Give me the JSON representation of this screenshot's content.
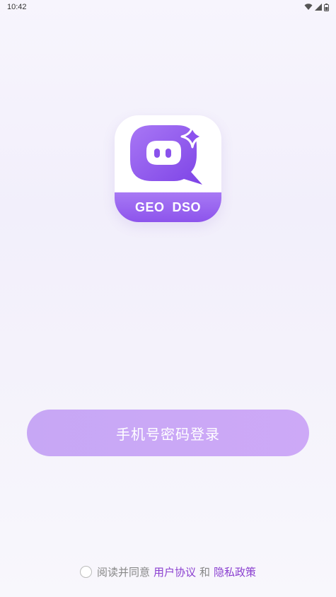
{
  "status_bar": {
    "time": "10:42",
    "icons": [
      "wifi-icon",
      "signal-icon",
      "battery-icon"
    ]
  },
  "logo": {
    "band_text": "GEO  DSO",
    "icon": "chat-bubble-sparkle-icon",
    "band_color": "#9a66f0",
    "mark_color": "#8c52ee"
  },
  "login": {
    "button_label": "手机号密码登录"
  },
  "agreement": {
    "prefix": "阅读并同意",
    "user_agreement": "用户协议",
    "and": "和",
    "privacy_policy": "隐私政策"
  }
}
